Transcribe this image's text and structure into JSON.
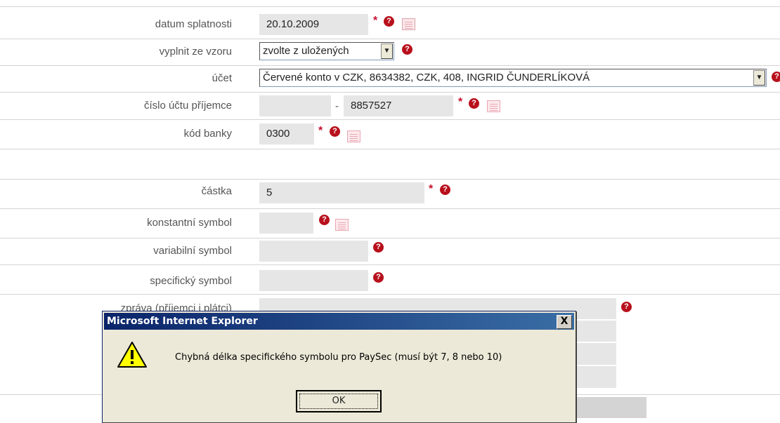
{
  "form": {
    "due_date": {
      "label": "datum splatnosti",
      "value": "20.10.2009"
    },
    "template": {
      "label": "vyplnit ze vzoru",
      "value": "zvolte z uložených"
    },
    "account": {
      "label": "účet",
      "value": "Červené konto v CZK, 8634382, CZK, 408, INGRID ČUNDERLÍKOVÁ"
    },
    "recipient_account": {
      "label": "číslo účtu příjemce",
      "prefix": "",
      "number": "8857527"
    },
    "bank_code": {
      "label": "kód banky",
      "value": "0300"
    },
    "amount": {
      "label": "částka",
      "value": "5"
    },
    "constant_symbol": {
      "label": "konstantní symbol",
      "value": ""
    },
    "variable_symbol": {
      "label": "variabilní symbol",
      "value": ""
    },
    "specific_symbol": {
      "label": "specifický symbol",
      "value": ""
    },
    "message": {
      "label": "zpráva (příjemci i plátci)",
      "value": ""
    },
    "required_mark": "*",
    "help_mark": "?"
  },
  "dialog": {
    "title": "Microsoft Internet Explorer",
    "close_label": "X",
    "message": "Chybná délka specifického symbolu pro PaySec (musí být 7, 8 nebo 10)",
    "ok_label": "OK"
  },
  "colors": {
    "required": "#c8102e",
    "help": "#b8101c",
    "field_bg": "#e6e6e6",
    "dialog_title": "#0a246a"
  }
}
